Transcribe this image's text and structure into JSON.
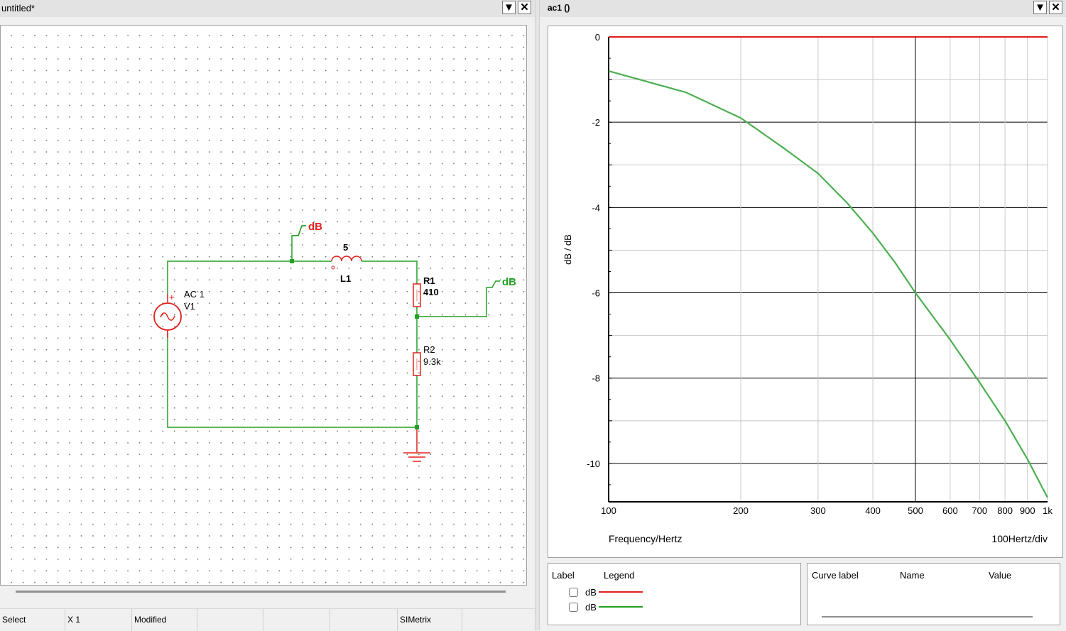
{
  "schematic_window": {
    "title": "untitled*",
    "menu_icon": "down-triangle",
    "close_icon": "close-x",
    "probes": [
      "dB",
      "dB"
    ],
    "components": {
      "source_value": "AC 1",
      "source_name": "V1",
      "source_plus": "+",
      "inductor_value": "5",
      "inductor_name": "L1",
      "r1_name": "R1",
      "r1_value": "410",
      "r2_name": "R2",
      "r2_value": "9.3k"
    }
  },
  "status_bar": {
    "mode": "Select",
    "zoom": "X 1",
    "state": "Modified",
    "app": "SIMetrix"
  },
  "graph_window": {
    "title": "ac1 ()",
    "menu_icon": "down-triangle",
    "close_icon": "close-x",
    "x_label": "Frequency/Hertz",
    "x_scale": "100Hertz/div",
    "y_label": "dB / dB",
    "legend_headers": [
      "Label",
      "Legend"
    ],
    "legend_items": [
      {
        "label": "dB",
        "color": "#e0201c"
      },
      {
        "label": "dB",
        "color": "#22a022"
      }
    ],
    "cursor_headers": [
      "Curve label",
      "Name",
      "Value"
    ]
  },
  "colors": {
    "probe_red": "#e0201c",
    "wire_green": "#22a022",
    "curve_green": "#4caf50"
  },
  "chart_data": {
    "type": "line",
    "xlabel": "Frequency/Hertz",
    "ylabel": "dB / dB",
    "x_scale": "log",
    "xlim": [
      100,
      1000
    ],
    "ylim": [
      -10.9,
      0
    ],
    "x_ticks": [
      100,
      200,
      300,
      400,
      500,
      600,
      700,
      800,
      900,
      1000
    ],
    "x_tick_labels": [
      "100",
      "200",
      "300",
      "400",
      "500",
      "600",
      "700",
      "800",
      "900",
      "1k"
    ],
    "y_ticks": [
      0,
      -2,
      -4,
      -6,
      -8,
      -10
    ],
    "y_tick_labels": [
      "0",
      "-2",
      "-4",
      "-6",
      "-8",
      "-10"
    ],
    "grid": true,
    "series": [
      {
        "name": "dB",
        "color": "#e0201c",
        "x": [
          100,
          1000
        ],
        "y": [
          0,
          0
        ]
      },
      {
        "name": "dB",
        "color": "#4caf50",
        "x": [
          100,
          150,
          200,
          250,
          300,
          350,
          400,
          450,
          500,
          600,
          700,
          800,
          900,
          1000
        ],
        "y": [
          -0.8,
          -1.3,
          -1.9,
          -2.6,
          -3.2,
          -3.9,
          -4.6,
          -5.3,
          -6.0,
          -7.1,
          -8.1,
          -9.0,
          -9.9,
          -10.8
        ]
      }
    ]
  }
}
